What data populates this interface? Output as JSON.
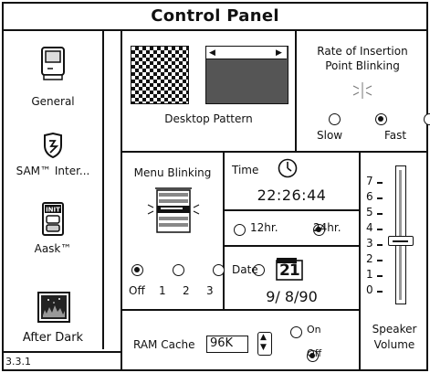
{
  "window": {
    "title": "Control Panel",
    "version": "3.3.1"
  },
  "sidebar": {
    "items": [
      {
        "label": "General",
        "icon": "general-mac-icon"
      },
      {
        "label": "SAM™ Inter...",
        "icon": "sam-shield-icon"
      },
      {
        "label": "Aask™",
        "icon": "init-card-icon"
      },
      {
        "label": "After Dark",
        "icon": "after-dark-screen-icon"
      }
    ]
  },
  "desktop": {
    "label": "Desktop Pattern"
  },
  "insertion": {
    "title_line1": "Rate of Insertion",
    "title_line2": "Point Blinking",
    "options": [
      "Slow",
      "",
      "Fast"
    ],
    "selected_index": 1
  },
  "menu_blinking": {
    "title": "Menu Blinking",
    "options": [
      "Off",
      "1",
      "2",
      "3"
    ],
    "selected_index": 0
  },
  "time": {
    "label": "Time",
    "value": "22:26:44",
    "format_12": "12hr.",
    "format_24": "24hr.",
    "selected_format": "24hr."
  },
  "date": {
    "label": "Date",
    "value": "9/ 8/90",
    "calendar_day": "21"
  },
  "speaker": {
    "ticks": [
      "7",
      "6",
      "5",
      "4",
      "3",
      "2",
      "1",
      "0"
    ],
    "level": 3,
    "label_line1": "Speaker",
    "label_line2": "Volume"
  },
  "ram_cache": {
    "label": "RAM Cache",
    "value": "96K",
    "on_label": "On",
    "off_label": "Off",
    "selected": "Off"
  }
}
